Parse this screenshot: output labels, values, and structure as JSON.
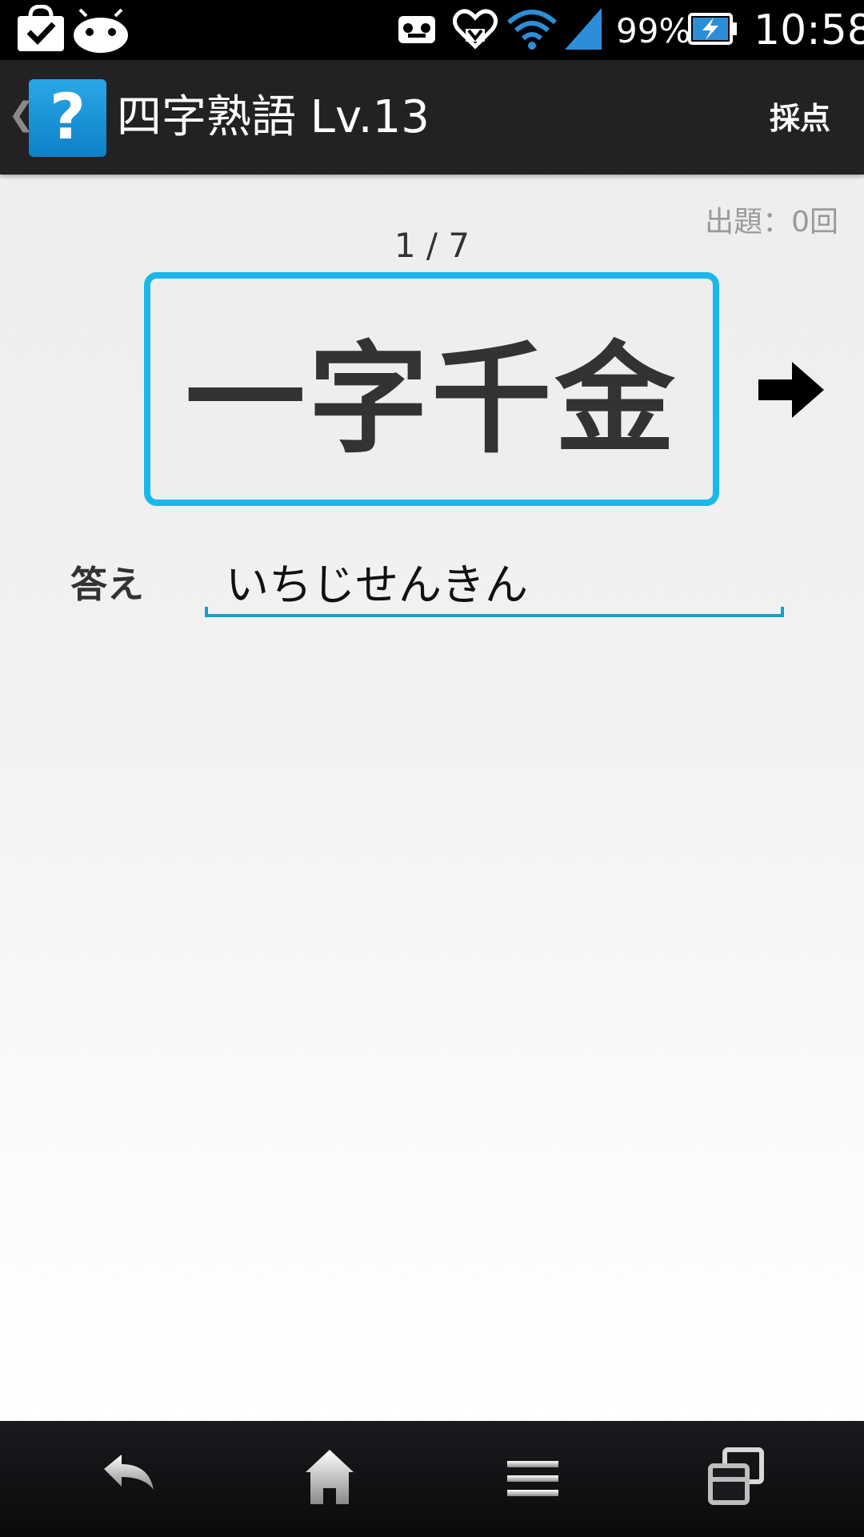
{
  "status_bar": {
    "battery": "99%",
    "time": "10:58",
    "icons": [
      "shopping-bag-check-icon",
      "android-icon",
      "voicemail-icon",
      "heart-download-icon",
      "wifi-icon",
      "signal-icon",
      "battery-charging-icon"
    ]
  },
  "action_bar": {
    "title": "四字熟語 Lv.13",
    "app_icon_glyph": "?",
    "score_label": "採点"
  },
  "quiz": {
    "question_count": "出題：0回",
    "page": "1 / 7",
    "idiom": "一字千金",
    "answer_label": "答え",
    "answer_value": "いちじせんきん"
  },
  "nav_bar": {
    "buttons": [
      "back-icon",
      "home-icon",
      "menu-icon",
      "recent-apps-icon"
    ]
  },
  "colors": {
    "accent": "#1ab8ea",
    "underline": "#1a9ec8",
    "action_bar": "#222224"
  }
}
